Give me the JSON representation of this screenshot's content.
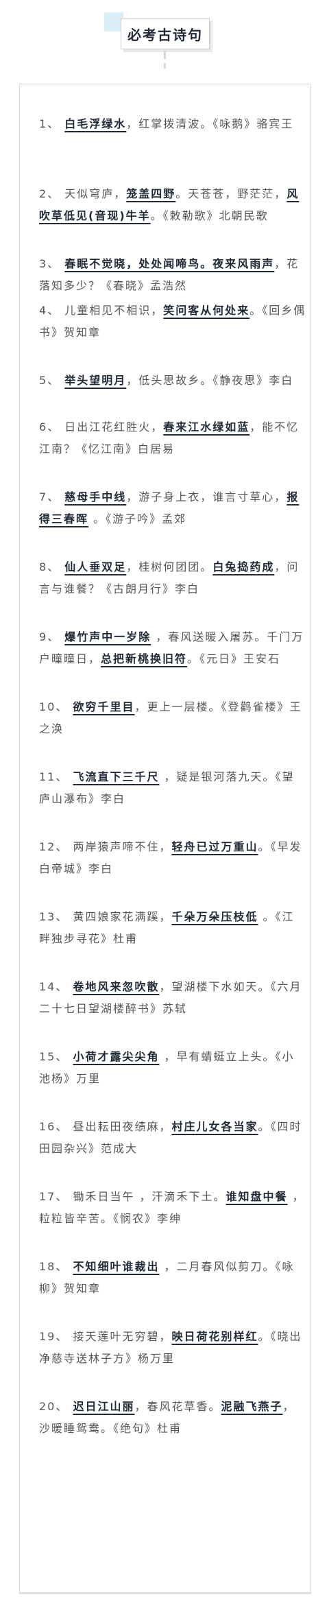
{
  "title": "必考古诗句",
  "items": [
    {
      "no": "1",
      "parts": [
        {
          "t": "、 "
        },
        {
          "t": "白毛浮绿水",
          "h": true
        },
        {
          "t": "，红掌拨清波。《咏鹅》骆宾王"
        }
      ]
    },
    {
      "no": "2",
      "parts": [
        {
          "t": "、 天似穹庐，"
        },
        {
          "t": "笼盖四野",
          "h": true
        },
        {
          "t": "。天苍苍，野茫茫，"
        },
        {
          "t": "风吹草低见(音现)牛羊",
          "h": true
        },
        {
          "t": "。《敕勒歌》北朝民歌"
        }
      ]
    },
    {
      "no": "3",
      "parts": [
        {
          "t": "、 "
        },
        {
          "t": "春眠不觉晓，处处闻啼鸟。夜来风雨声",
          "h": true
        },
        {
          "t": "，花落知多少？《春晓》孟浩然"
        }
      ]
    },
    {
      "no": "4",
      "parts": [
        {
          "t": "、 儿童相见不相识，"
        },
        {
          "t": "笑问客从何处来",
          "h": true
        },
        {
          "t": "。《回乡偶书》贺知章"
        }
      ]
    },
    {
      "no": "5",
      "parts": [
        {
          "t": "、 "
        },
        {
          "t": "举头望明月",
          "h": true
        },
        {
          "t": "，低头思故乡。《静夜思》李白"
        }
      ]
    },
    {
      "no": "6",
      "parts": [
        {
          "t": "、 日出江花红胜火，"
        },
        {
          "t": "春来江水绿如蓝",
          "h": true
        },
        {
          "t": "，能不忆江南？《忆江南》白居易"
        }
      ]
    },
    {
      "no": "7",
      "parts": [
        {
          "t": "、 "
        },
        {
          "t": "慈母手中线",
          "h": true
        },
        {
          "t": "，游子身上衣，谁言寸草心，"
        },
        {
          "t": "报得三春晖",
          "h": true
        },
        {
          "t": " 。《游子吟》孟郊"
        }
      ]
    },
    {
      "no": "8",
      "parts": [
        {
          "t": "、 "
        },
        {
          "t": "仙人垂双足",
          "h": true
        },
        {
          "t": "，桂树何团团。"
        },
        {
          "t": "白兔捣药成",
          "h": true
        },
        {
          "t": "，问言与谁餐？《古朗月行》李白"
        }
      ]
    },
    {
      "no": "9",
      "parts": [
        {
          "t": "、 "
        },
        {
          "t": "爆竹声中一岁除",
          "h": true
        },
        {
          "t": " ，春风送暖入屠苏。千门万户曈曈日，"
        },
        {
          "t": "总把新桃换旧符",
          "h": true
        },
        {
          "t": "。《元日》王安石"
        }
      ]
    },
    {
      "no": "10",
      "parts": [
        {
          "t": "、 "
        },
        {
          "t": "欲穷千里目",
          "h": true
        },
        {
          "t": "，更上一层楼。《登鹳雀楼》王之涣"
        }
      ]
    },
    {
      "no": "11",
      "parts": [
        {
          "t": "、 "
        },
        {
          "t": "飞流直下三千尺",
          "h": true
        },
        {
          "t": " ，疑是银河落九天。《望庐山瀑布》李白"
        }
      ]
    },
    {
      "no": "12",
      "parts": [
        {
          "t": "、 两岸猿声啼不住，"
        },
        {
          "t": "轻舟已过万重山",
          "h": true
        },
        {
          "t": "。《早发白帝城》李白"
        }
      ]
    },
    {
      "no": "13",
      "parts": [
        {
          "t": "、 黄四娘家花满蹊，"
        },
        {
          "t": "千朵万朵压枝低",
          "h": true
        },
        {
          "t": " 。《江畔独步寻花》杜甫"
        }
      ]
    },
    {
      "no": "14",
      "parts": [
        {
          "t": "、 "
        },
        {
          "t": "卷地风来忽吹散",
          "h": true
        },
        {
          "t": "，望湖楼下水如天。《六月二十七日望湖楼醉书》苏轼"
        }
      ]
    },
    {
      "no": "15",
      "parts": [
        {
          "t": "、 "
        },
        {
          "t": "小荷才露尖尖角",
          "h": true
        },
        {
          "t": " ，早有蜻蜓立上头。《小池杨》万里"
        }
      ]
    },
    {
      "no": "16",
      "parts": [
        {
          "t": "、 昼出耘田夜绩麻，"
        },
        {
          "t": "村庄儿女各当家",
          "h": true
        },
        {
          "t": "。《四时田园杂兴》范成大"
        }
      ]
    },
    {
      "no": "17",
      "parts": [
        {
          "t": "、 锄禾日当午 ，汗滴禾下土。"
        },
        {
          "t": "谁知盘中餐",
          "h": true
        },
        {
          "t": " ，粒粒皆辛苦。《悯农》李绅"
        }
      ]
    },
    {
      "no": "18",
      "parts": [
        {
          "t": "、 "
        },
        {
          "t": "不知细叶谁裁出",
          "h": true
        },
        {
          "t": " ，二月春风似剪刀。《咏柳》贺知章"
        }
      ]
    },
    {
      "no": "19",
      "parts": [
        {
          "t": "、 接天莲叶无穷碧，"
        },
        {
          "t": "映日荷花别样红",
          "h": true
        },
        {
          "t": "。《晓出净慈寺送林子方》杨万里"
        }
      ]
    },
    {
      "no": "20",
      "parts": [
        {
          "t": "、 "
        },
        {
          "t": "迟日江山丽",
          "h": true
        },
        {
          "t": "，春风花草香。"
        },
        {
          "t": "泥融飞燕子",
          "h": true
        },
        {
          "t": "，沙暖睡鸳鸯。《绝句》杜甫"
        }
      ]
    }
  ]
}
